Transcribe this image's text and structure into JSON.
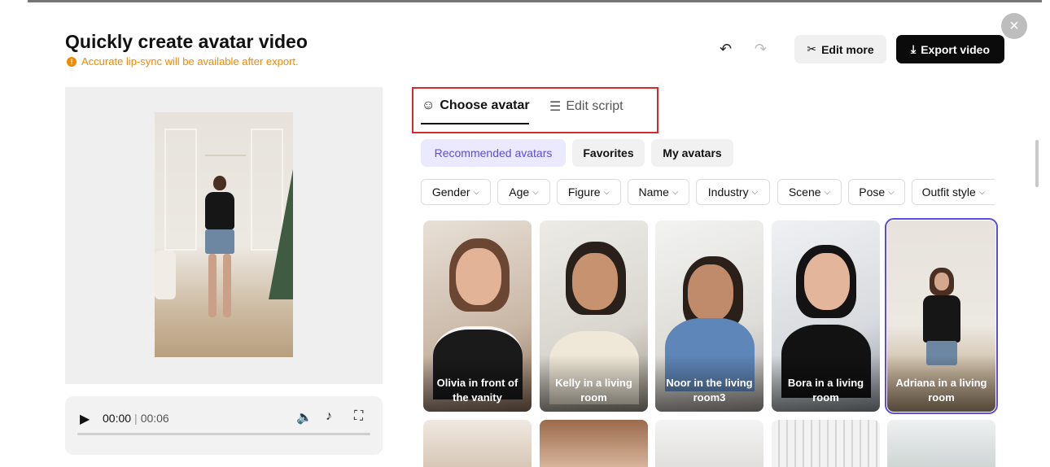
{
  "header": {
    "title": "Quickly create avatar video",
    "notice": "Accurate lip-sync will be available after export.",
    "notice_icon": "!",
    "close_glyph": "×",
    "undo_glyph": "↶",
    "redo_glyph": "↷",
    "edit_more_icon": "✂",
    "edit_more_label": "Edit more",
    "export_icon": "⤓",
    "export_label": "Export video"
  },
  "player": {
    "current_time": "00:00",
    "separator": "|",
    "duration": "00:06",
    "play_glyph": "▶",
    "volume_glyph": "🔈",
    "tiktok_glyph": "♪",
    "fullscreen_glyph": "⛶"
  },
  "tabs": {
    "choose_avatar_icon": "☺",
    "choose_avatar": "Choose avatar",
    "edit_script_icon": "☰",
    "edit_script": "Edit script"
  },
  "chips": {
    "recommended": "Recommended avatars",
    "favorites": "Favorites",
    "my_avatars": "My avatars"
  },
  "filters": [
    {
      "label": "Gender"
    },
    {
      "label": "Age"
    },
    {
      "label": "Figure"
    },
    {
      "label": "Name"
    },
    {
      "label": "Industry"
    },
    {
      "label": "Scene"
    },
    {
      "label": "Pose"
    },
    {
      "label": "Outfit style"
    }
  ],
  "filter_chevron": "⌵",
  "avatars": [
    {
      "label": "Olivia in front of the vanity"
    },
    {
      "label": "Kelly in a living room"
    },
    {
      "label": "Noor in the living room3"
    },
    {
      "label": "Bora in a living room"
    },
    {
      "label": "Adriana in a living room"
    }
  ],
  "colors": {
    "accent": "#5b4ddb",
    "warning": "#f08a00",
    "highlight_box": "#d62b2b",
    "export_bg": "#0b0b0b"
  }
}
